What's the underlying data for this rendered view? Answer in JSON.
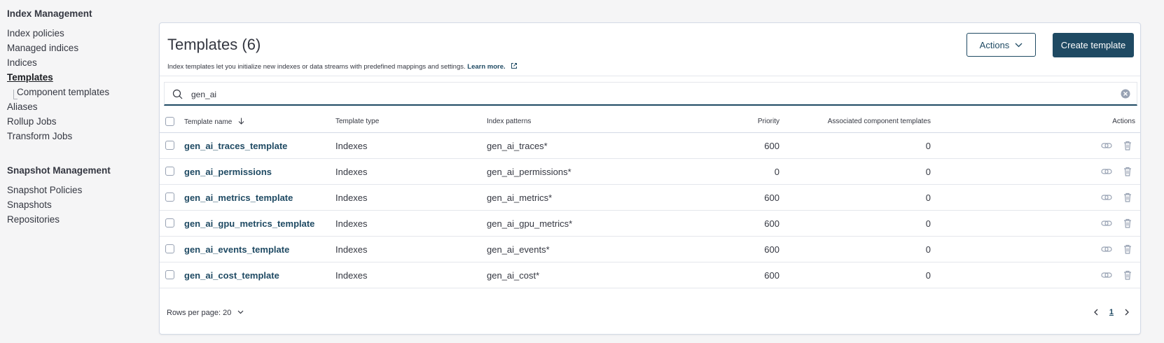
{
  "sidebar": {
    "index_management_title": "Index Management",
    "index_items": [
      {
        "label": "Index policies"
      },
      {
        "label": "Managed indices"
      },
      {
        "label": "Indices"
      },
      {
        "label": "Templates",
        "active": true
      },
      {
        "label": "Component templates",
        "child": true
      },
      {
        "label": "Aliases"
      },
      {
        "label": "Rollup Jobs"
      },
      {
        "label": "Transform Jobs"
      }
    ],
    "snapshot_management_title": "Snapshot Management",
    "snapshot_items": [
      {
        "label": "Snapshot Policies"
      },
      {
        "label": "Snapshots"
      },
      {
        "label": "Repositories"
      }
    ]
  },
  "page": {
    "title": "Templates (6)",
    "description": "Index templates let you initialize new indexes or data streams with predefined mappings and settings.",
    "learn_more": "Learn more.",
    "actions_label": "Actions",
    "create_label": "Create template"
  },
  "search": {
    "value": "gen_ai"
  },
  "table": {
    "headers": {
      "name": "Template name",
      "type": "Template type",
      "patterns": "Index patterns",
      "priority": "Priority",
      "components": "Associated component templates",
      "actions": "Actions"
    },
    "rows": [
      {
        "name": "gen_ai_traces_template",
        "type": "Indexes",
        "patterns": "gen_ai_traces*",
        "priority": "600",
        "components": "0"
      },
      {
        "name": "gen_ai_permissions",
        "type": "Indexes",
        "patterns": "gen_ai_permissions*",
        "priority": "0",
        "components": "0"
      },
      {
        "name": "gen_ai_metrics_template",
        "type": "Indexes",
        "patterns": "gen_ai_metrics*",
        "priority": "600",
        "components": "0"
      },
      {
        "name": "gen_ai_gpu_metrics_template",
        "type": "Indexes",
        "patterns": "gen_ai_gpu_metrics*",
        "priority": "600",
        "components": "0"
      },
      {
        "name": "gen_ai_events_template",
        "type": "Indexes",
        "patterns": "gen_ai_events*",
        "priority": "600",
        "components": "0"
      },
      {
        "name": "gen_ai_cost_template",
        "type": "Indexes",
        "patterns": "gen_ai_cost*",
        "priority": "600",
        "components": "0"
      }
    ]
  },
  "footer": {
    "rows_per_page": "Rows per page: 20",
    "current_page": "1"
  },
  "colors": {
    "primary": "#1f4a63",
    "text": "#343741",
    "background": "#f5f5f6"
  }
}
